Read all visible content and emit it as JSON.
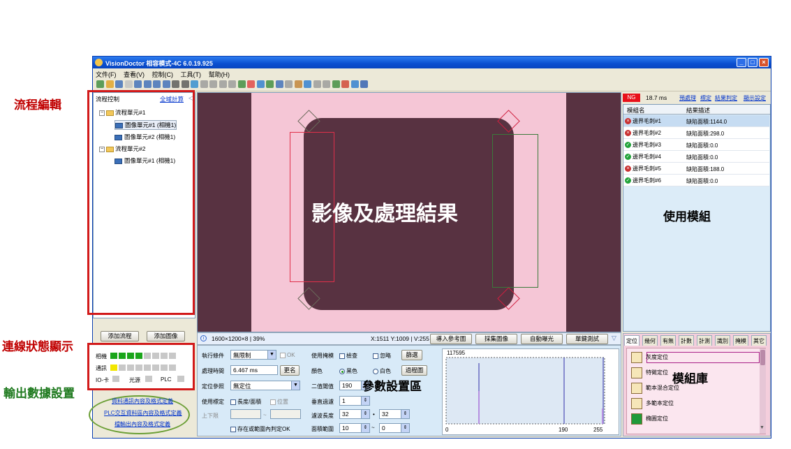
{
  "annotations": {
    "flow_edit": "流程編輯",
    "connection_status": "連線狀態顯示",
    "output_data": "輸出數據設置",
    "image_result": "影像及處理結果",
    "use_module": "使用模組",
    "param_area": "參數設置區",
    "module_lib": "模組庫"
  },
  "window": {
    "title": "VisionDoctor 相容模式-4C 6.0.19.925",
    "min": "_",
    "max": "□",
    "close": "×"
  },
  "menu": [
    "文件(F)",
    "查看(V)",
    "控制(C)",
    "工具(T)",
    "幫助(H)"
  ],
  "flow": {
    "header": "流程控制",
    "link": "全域計算",
    "items": [
      {
        "label": "流程單元#1",
        "level": 0,
        "kind": "folder"
      },
      {
        "label": "圖像單元#1 (相機1)",
        "level": 1,
        "kind": "image"
      },
      {
        "label": "圖像單元#2 (相機1)",
        "level": 1,
        "kind": "image"
      },
      {
        "label": "流程單元#2",
        "level": 0,
        "kind": "folder"
      },
      {
        "label": "圖像單元#1 (相機1)",
        "level": 1,
        "kind": "image"
      }
    ],
    "add_flow": "添加流程",
    "add_image": "添加圖像"
  },
  "status": {
    "camera": "相機",
    "comm": "通訊",
    "io": "IO-卡",
    "light": "光源",
    "plc": "PLC",
    "camera_leds": [
      "on",
      "on",
      "on",
      "on",
      "off",
      "off",
      "off",
      "off"
    ],
    "comm_leds": [
      "warn",
      "off",
      "off",
      "off",
      "off",
      "off",
      "off",
      "off"
    ]
  },
  "output_links": [
    "資料通訊內容及格式定義",
    "PLC交互資料區內容及格式定義",
    "檔輸出內容及格式定義"
  ],
  "image": {
    "info": "1600×1200×8 | 39%",
    "coords": "X:1511 Y:1009 | V:255",
    "btn_ref": "導入參考圖",
    "btn_capture": "採集圖像",
    "btn_exposure": "自動曝光",
    "btn_test": "單鍵測試"
  },
  "params": {
    "trigger_lbl": "執行條件",
    "trigger_val": "無限制",
    "ok_lbl": "OK",
    "time_lbl": "處理時間",
    "time_val": "6.467 ms",
    "rename": "更名",
    "ref_lbl": "定位參照",
    "ref_val": "無定位",
    "std_lbl": "使用標定",
    "len_area": "長度/面積",
    "pos": "位置",
    "limit_lbl": "上下限",
    "tilde": "~",
    "in_range": "存在或範圍內判定OK",
    "mask_lbl": "使用掩模",
    "check": "檢查",
    "ignore": "忽略",
    "filter": "篩選",
    "color_lbl": "顏色",
    "black": "黑色",
    "white": "白色",
    "filter_img": "過程圖",
    "thresh_lbl": "二值閾值",
    "thresh_val": "190",
    "vfilter_lbl": "垂直過濾",
    "vfilter_val": "1",
    "wave_lbl": "濾波長度",
    "wave_a": "32",
    "wave_b": "32",
    "area_lbl": "面積範圍",
    "area_a": "10",
    "area_b": "0"
  },
  "histogram": {
    "max_label": "117595",
    "x_ticks": [
      "0",
      "190",
      "255"
    ]
  },
  "results": {
    "ng": "NG",
    "time": "18.7 ms",
    "links": [
      "預處理",
      "標定",
      "結果判定",
      "顯示設定"
    ],
    "col_name": "模組名",
    "col_desc": "結果描述",
    "rows": [
      {
        "name": "邊界毛刺#1",
        "desc": "缺陷面積:1144.0",
        "status": "ng"
      },
      {
        "name": "邊界毛刺#2",
        "desc": "缺陷面積:298.0",
        "status": "ng"
      },
      {
        "name": "邊界毛刺#3",
        "desc": "缺陷面積:0.0",
        "status": "ok"
      },
      {
        "name": "邊界毛刺#4",
        "desc": "缺陷面積:0.0",
        "status": "ok"
      },
      {
        "name": "邊界毛刺#5",
        "desc": "缺陷面積:188.0",
        "status": "ng"
      },
      {
        "name": "邊界毛刺#6",
        "desc": "缺陷面積:0.0",
        "status": "ok"
      }
    ]
  },
  "library": {
    "tabs": [
      "定位",
      "幾何",
      "有無",
      "計數",
      "計測",
      "識別",
      "掩模",
      "其它"
    ],
    "items": [
      "灰度定位",
      "特徵定位",
      "範本混合定位",
      "多範本定位",
      "橢圓定位"
    ]
  }
}
